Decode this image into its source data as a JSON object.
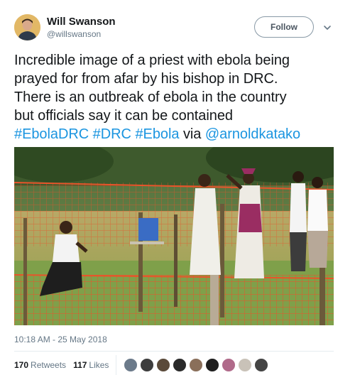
{
  "author": {
    "name": "Will Swanson",
    "handle": "@willswanson",
    "avatar_icon": "profile-photo"
  },
  "follow_label": "Follow",
  "tweet": {
    "lines": [
      "Incredible image of a priest with ebola being",
      "prayed for from afar by his bishop in DRC.",
      "There is an outbreak of ebola in the country",
      "but officials say it can be contained"
    ],
    "tags": [
      "#EbolaDRC",
      "#DRC",
      "#Ebola"
    ],
    "via": "via",
    "mention": "@arnoldkatako"
  },
  "timestamp": "10:18 AM - 25 May 2018",
  "stats": {
    "retweets_count": "170",
    "retweets_label": "Retweets",
    "likes_count": "117",
    "likes_label": "Likes"
  },
  "likers": [
    "#6b7a8a",
    "#3d3d3d",
    "#5a4a3a",
    "#2a2a2a",
    "#8a6f5a",
    "#1e1e1e",
    "#b06a8a",
    "#c9c2b8",
    "#444444"
  ],
  "colors": {
    "link": "#1b95e0",
    "text": "#14171a",
    "muted": "#657786"
  }
}
